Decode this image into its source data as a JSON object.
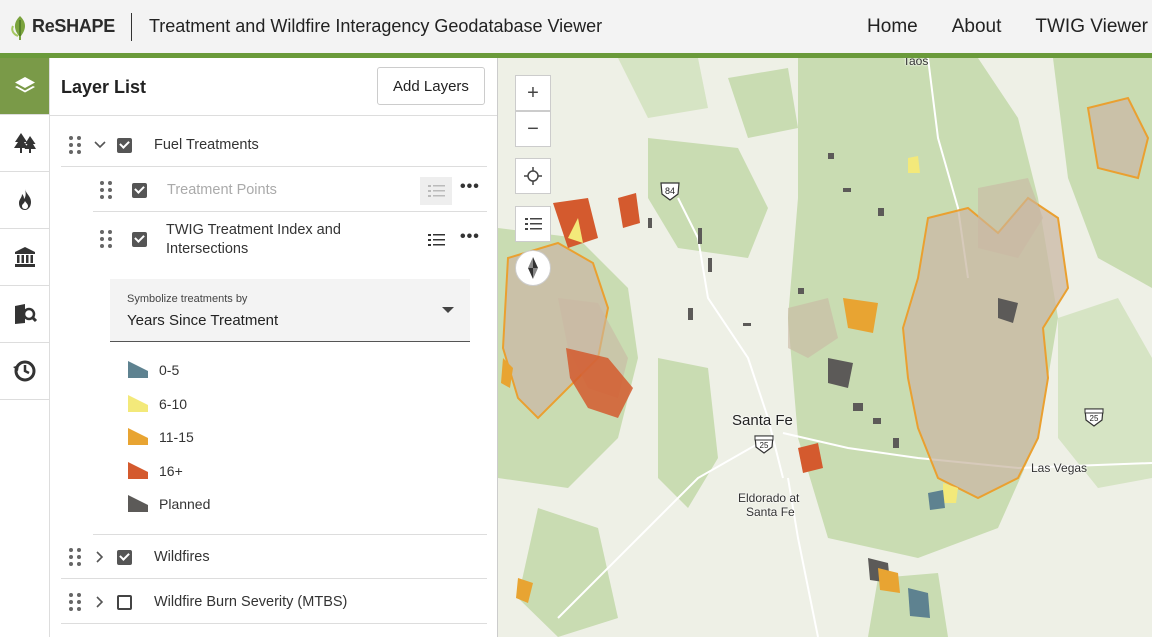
{
  "header": {
    "logo_text": "ReSHAPE",
    "app_title": "Treatment and Wildfire Interagency Geodatabase Viewer",
    "nav": [
      "Home",
      "About",
      "TWIG Viewer"
    ]
  },
  "rail": {
    "items": [
      "layers-icon",
      "trees-icon",
      "fire-icon",
      "bank-icon",
      "map-search-icon",
      "history-icon"
    ]
  },
  "panel": {
    "title": "Layer List",
    "add_button": "Add Layers",
    "layers": {
      "fuel_treatments": "Fuel Treatments",
      "treatment_points": "Treatment Points",
      "twig_line1": "TWIG Treatment Index and",
      "twig_line2": "Intersections",
      "wildfires": "Wildfires",
      "burn_severity": "Wildfire Burn Severity (MTBS)"
    },
    "symbolize": {
      "label": "Symbolize treatments by",
      "value": "Years Since Treatment"
    },
    "legend": [
      {
        "label": "0-5",
        "color": "#5e8290"
      },
      {
        "label": "6-10",
        "color": "#f3e97a"
      },
      {
        "label": "11-15",
        "color": "#e8a432"
      },
      {
        "label": "16+",
        "color": "#d45a2e"
      },
      {
        "label": "Planned",
        "color": "#5c5a58"
      }
    ]
  },
  "map": {
    "controls": [
      "+",
      "−"
    ],
    "places": {
      "taos": "Taos",
      "santa_fe": "Santa Fe",
      "eldorado1": "Eldorado at",
      "eldorado2": "Santa Fe",
      "las_vegas": "Las Vegas"
    },
    "shields": {
      "us84": "84",
      "i25a": "25",
      "i25b": "25"
    },
    "colors": {
      "forest": "#c9dcb2",
      "burn": "#c9b8a4",
      "burn_outline": "#eaa030",
      "base": "#eef0e6"
    }
  }
}
